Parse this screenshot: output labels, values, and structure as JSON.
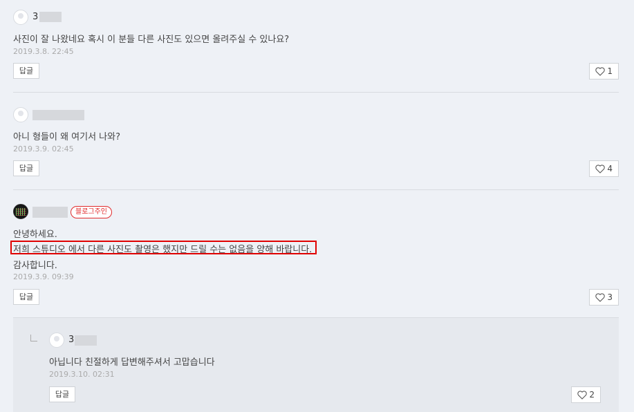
{
  "comments": [
    {
      "nick_visible": "3",
      "text": "사진이 잘 나왔네요 혹시 이 분들 다른 사진도 있으면 올려주실 수 있나요?",
      "date": "2019.3.8. 22:45",
      "reply_label": "답글",
      "likes": "1"
    },
    {
      "nick_visible": "",
      "text": "아니 형들이 왜 여기서 나와?",
      "date": "2019.3.9. 02:45",
      "reply_label": "답글",
      "likes": "4"
    },
    {
      "nick_visible": "",
      "badge": "블로그주인",
      "lines": [
        "안녕하세요.",
        "저희 스튜디오 에서 다른 사진도 촬영은 했지만 드릴 수는 없음을 양해 바랍니다.",
        "감사합니다."
      ],
      "date": "2019.3.9. 09:39",
      "reply_label": "답글",
      "likes": "3"
    }
  ],
  "reply": {
    "nick_visible": "3",
    "text": "아닙니다 친절하게 답변해주셔서 고맙습니다",
    "date": "2019.3.10. 02:31",
    "reply_label": "답글",
    "likes": "2"
  },
  "colors": {
    "highlight": "#e00000",
    "badge": "#e0292a"
  },
  "icons": {
    "like": "heart-outline-icon",
    "reply_indent": "reply-arrow-icon"
  }
}
